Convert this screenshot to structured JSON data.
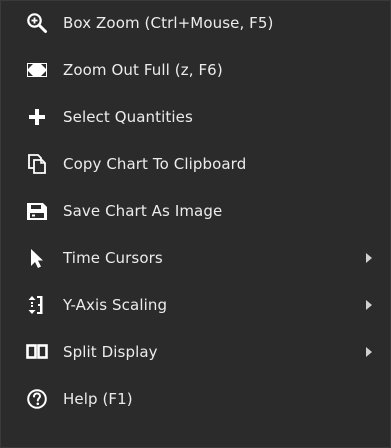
{
  "menu": {
    "items": [
      {
        "label": "Box Zoom (Ctrl+Mouse, F5)",
        "icon": "zoom-in-icon",
        "submenu": false
      },
      {
        "label": "Zoom Out Full (z, F6)",
        "icon": "zoom-out-full-icon",
        "submenu": false
      },
      {
        "label": "Select Quantities",
        "icon": "plus-icon",
        "submenu": false
      },
      {
        "label": "Copy Chart To Clipboard",
        "icon": "copy-icon",
        "submenu": false
      },
      {
        "label": "Save Chart As Image",
        "icon": "save-icon",
        "submenu": false
      },
      {
        "label": "Time Cursors",
        "icon": "cursor-arrow-icon",
        "submenu": true
      },
      {
        "label": "Y-Axis Scaling",
        "icon": "y-axis-scaling-icon",
        "submenu": true
      },
      {
        "label": "Split Display",
        "icon": "split-display-icon",
        "submenu": true
      },
      {
        "label": "Help (F1)",
        "icon": "help-icon",
        "submenu": false
      }
    ]
  },
  "colors": {
    "background": "#2b2b2b",
    "text": "#ececec",
    "icon": "#ffffff"
  }
}
